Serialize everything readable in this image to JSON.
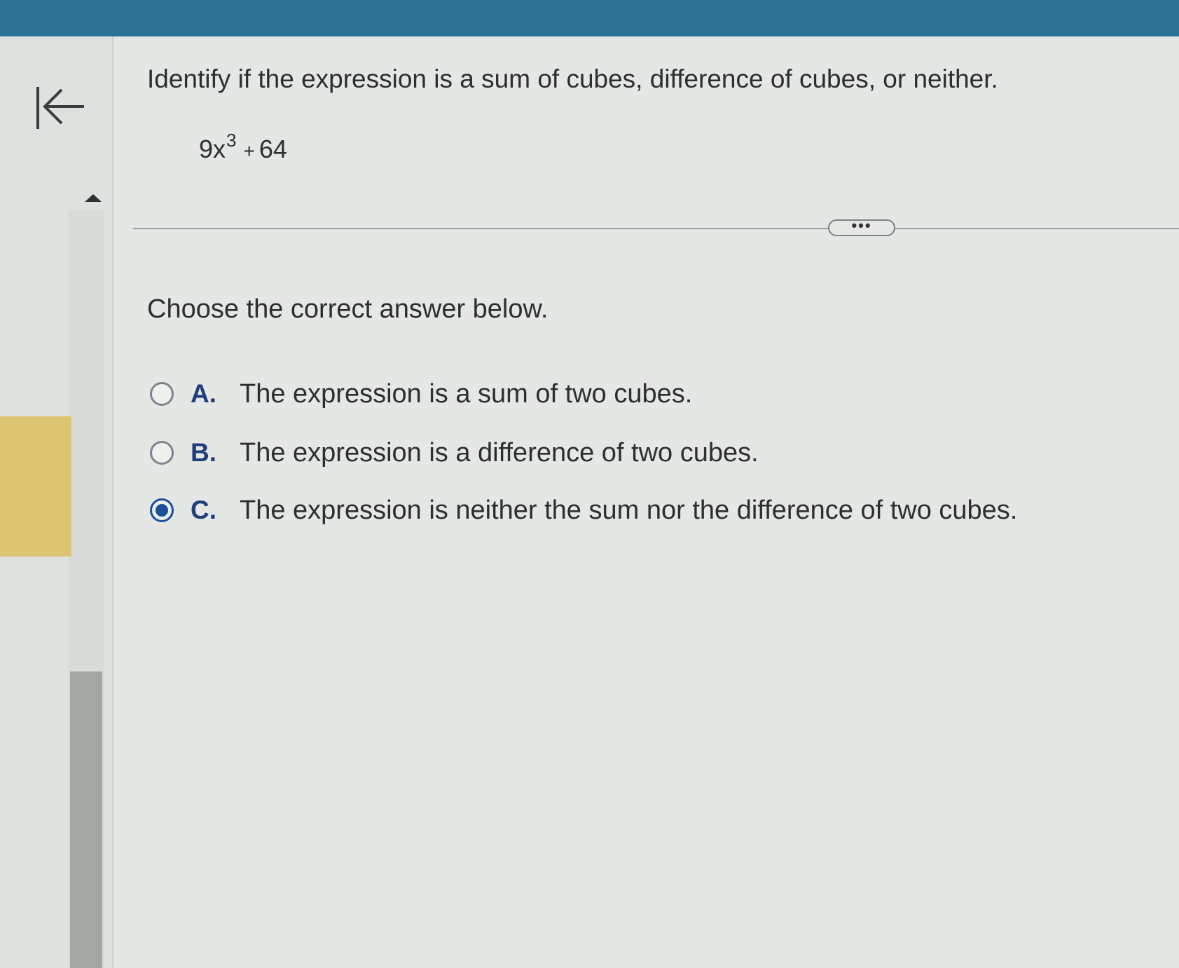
{
  "header": {
    "color": "#2d7394"
  },
  "sidebar": {
    "collapse_icon": "collapse-left-arrow-icon",
    "scroll_icon": "caret-up-icon",
    "highlight_color": "#dcc470"
  },
  "question": {
    "prompt": "Identify if the expression is a sum of cubes, difference of cubes, or neither.",
    "expression": {
      "coefficient_base": "9x",
      "exponent": "3",
      "operator": "+",
      "constant": "64"
    },
    "more_button_label": "•••"
  },
  "answer": {
    "instruction": "Choose the correct answer below.",
    "options": [
      {
        "letter": "A.",
        "text": "The expression is a sum of two cubes.",
        "selected": false
      },
      {
        "letter": "B.",
        "text": "The expression is a difference of two cubes.",
        "selected": false
      },
      {
        "letter": "C.",
        "text": "The expression is neither the sum nor the difference of two cubes.",
        "selected": true
      }
    ],
    "selected_color": "#1d4f9c"
  }
}
